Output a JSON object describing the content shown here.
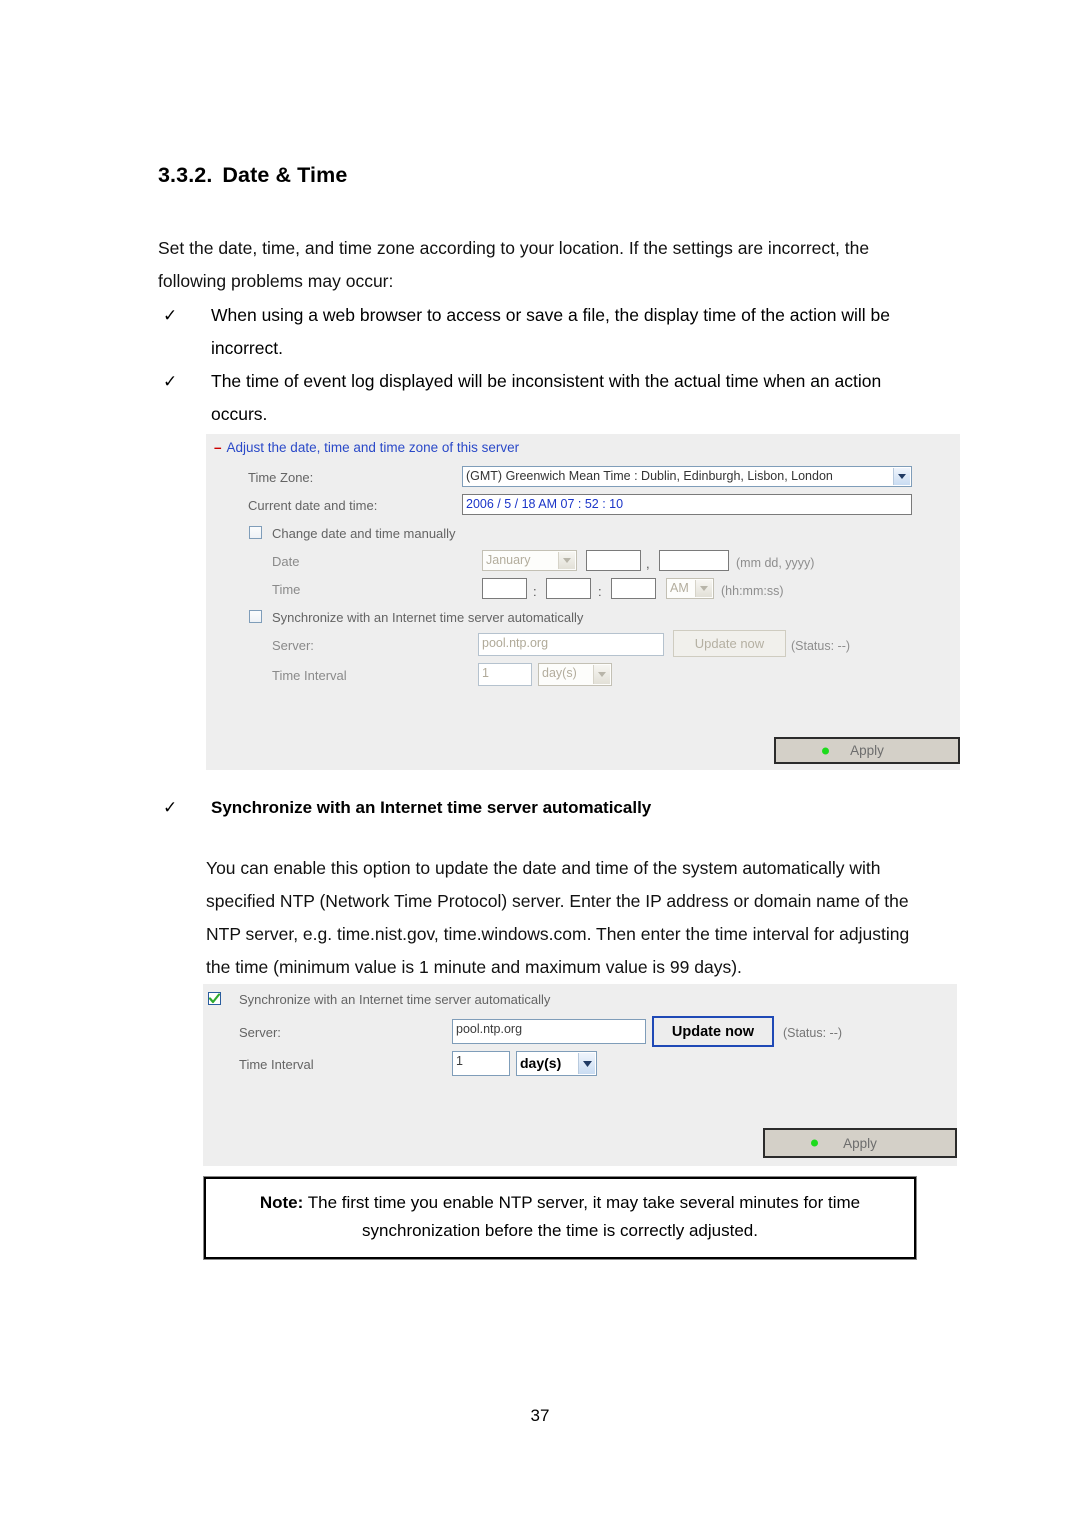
{
  "document": {
    "heading_number": "3.3.2.",
    "heading_title": "Date & Time",
    "intro": "Set the date, time, and time zone according to your location.  If the settings are incorrect, the following problems may occur:",
    "bullets": [
      "When using a web browser to access or save a file, the display time of the action will be incorrect.",
      "The time of event log displayed will be inconsistent with the actual time when an action occurs."
    ],
    "check_glyph": "✓",
    "sync_bullet_title": "Synchronize with an Internet time server automatically",
    "sync_paragraph": "You can enable this option to update the date and time of the system automatically with specified NTP (Network Time Protocol) server.  Enter the IP address or domain name of the NTP server, e.g. time.nist.gov, time.windows.com.  Then enter the time interval for adjusting the time (minimum value is 1 minute and maximum value is 99 days).",
    "note_label": "Note:",
    "note_text": " The first time you enable NTP server, it may take several minutes for time synchronization before the time is correctly adjusted.",
    "page_number": "37"
  },
  "panel1": {
    "header_minus": "–",
    "header_title": "Adjust the date, time and time zone of this server",
    "timezone_label": "Time Zone:",
    "timezone_value": "(GMT) Greenwich Mean Time : Dublin, Edinburgh, Lisbon, London",
    "current_label": "Current date and time:",
    "current_value": "2006 / 5 / 18 AM 07 : 52 : 10",
    "manual_checkbox_label": "Change date and time manually",
    "date_label": "Date",
    "date_month": "January",
    "date_day": "",
    "date_year": "",
    "date_comma": ",",
    "date_hint": "(mm dd, yyyy)",
    "time_label": "Time",
    "time_hour": "",
    "time_minute": "",
    "time_second": "",
    "time_colon": ":",
    "time_meridiem": "AM",
    "time_hint": "(hh:mm:ss)",
    "sync_checkbox_label": "Synchronize with an Internet time server automatically",
    "server_label": "Server:",
    "server_value": "pool.ntp.org",
    "update_button": "Update now",
    "status_text": "(Status: --)",
    "interval_label": "Time Interval",
    "interval_value": "1",
    "interval_unit": "day(s)",
    "apply_button": "Apply",
    "indicator_color": "#1ddb1d"
  },
  "panel2": {
    "sync_checkbox_label": "Synchronize with an Internet time server automatically",
    "server_label": "Server:",
    "server_value": "pool.ntp.org",
    "update_button": "Update now",
    "status_text": "(Status: --)",
    "interval_label": "Time Interval",
    "interval_value": "1",
    "interval_unit": "day(s)",
    "apply_button": "Apply",
    "indicator_color": "#1ddb1d"
  }
}
